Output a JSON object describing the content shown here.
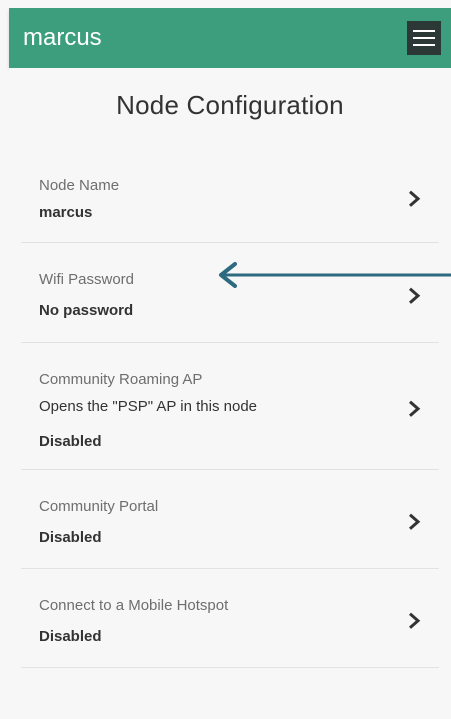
{
  "appbar": {
    "title": "marcus",
    "menu_icon": "hamburger-menu-icon"
  },
  "page": {
    "title": "Node Configuration"
  },
  "items": [
    {
      "label": "Node Name",
      "description": "",
      "value": "marcus"
    },
    {
      "label": "Wifi Password",
      "description": "",
      "value": "No password"
    },
    {
      "label": "Community Roaming AP",
      "description": "Opens the \"PSP\" AP in this node",
      "value": "Disabled"
    },
    {
      "label": "Community Portal",
      "description": "",
      "value": "Disabled"
    },
    {
      "label": "Connect to a Mobile Hotspot",
      "description": "",
      "value": "Disabled"
    }
  ],
  "colors": {
    "appbar": "#3d9e7e",
    "menu_button": "#2b3835",
    "annotation_arrow": "#2e6a80"
  },
  "icons": {
    "chevron": "chevron-right-icon",
    "annotation": "arrow-left-icon"
  }
}
